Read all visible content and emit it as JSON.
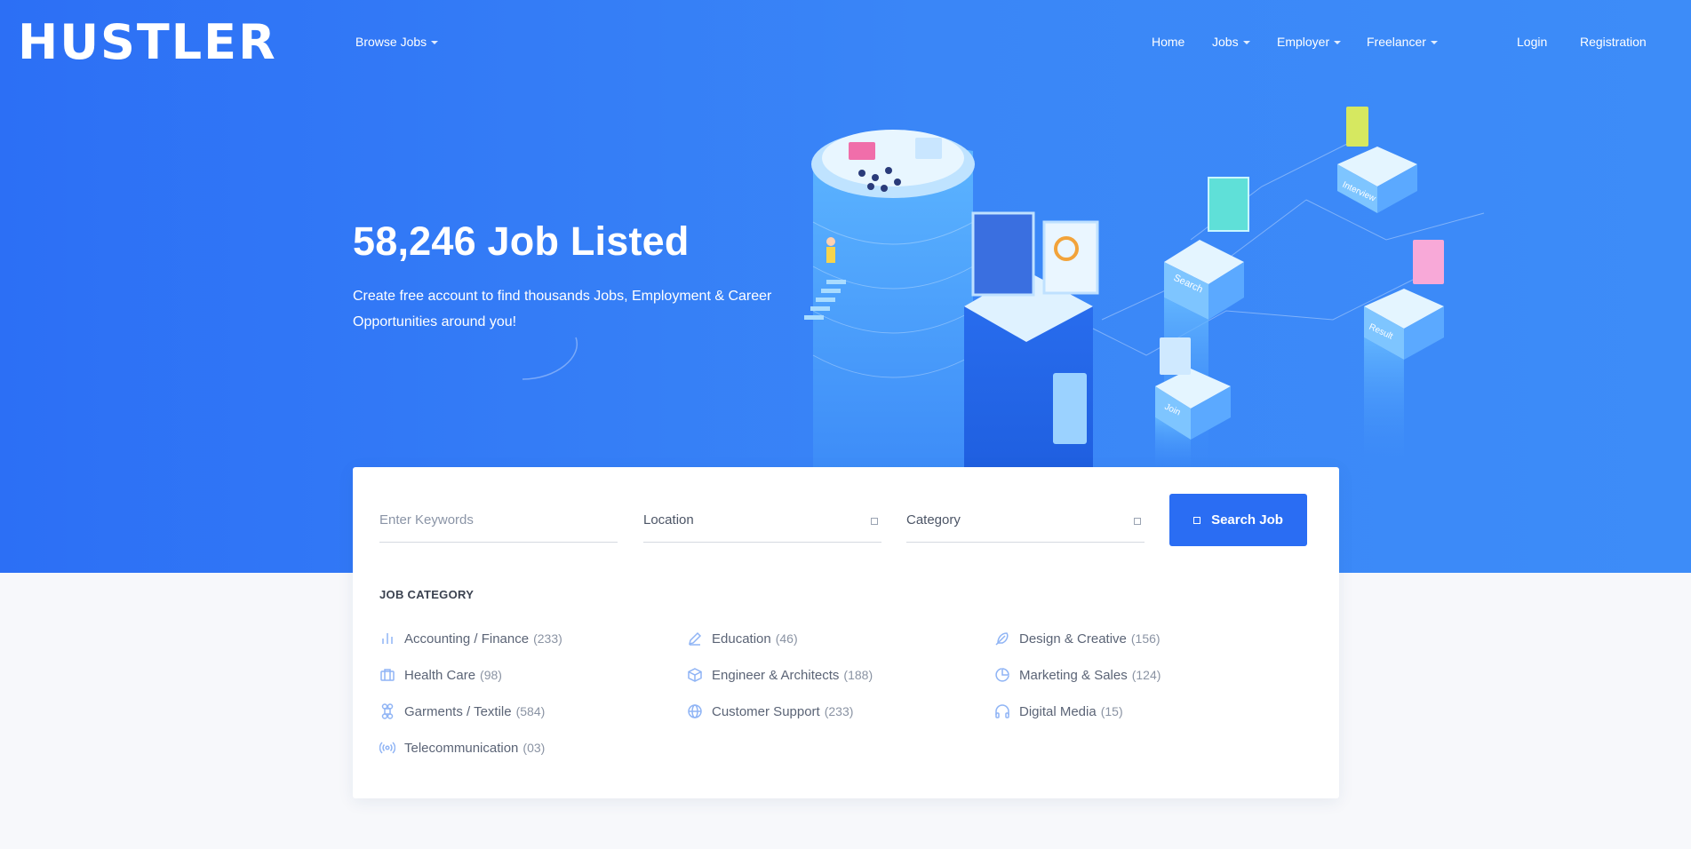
{
  "header": {
    "logo": "HUSTLER",
    "browse_jobs": "Browse Jobs",
    "nav": [
      "Home",
      "Jobs",
      "Employer",
      "Freelancer"
    ],
    "login": "Login",
    "registration": "Registration"
  },
  "hero": {
    "headline": "58,246 Job Listed",
    "subline": "Create free account to find thousands Jobs, Employment & Career Opportunities around you!"
  },
  "illustration_labels": [
    "Search",
    "Interview",
    "Join",
    "Result"
  ],
  "search": {
    "keywords_placeholder": "Enter Keywords",
    "location": "Location",
    "category": "Category",
    "button": "Search Job"
  },
  "categories": {
    "title": "JOB CATEGORY",
    "items": [
      {
        "label": "Accounting / Finance",
        "count": "(233)",
        "icon": "bar-chart-icon"
      },
      {
        "label": "Education",
        "count": "(46)",
        "icon": "pencil-icon"
      },
      {
        "label": "Design & Creative",
        "count": "(156)",
        "icon": "feather-icon"
      },
      {
        "label": "Health Care",
        "count": "(98)",
        "icon": "briefcase-icon"
      },
      {
        "label": "Engineer & Architects",
        "count": "(188)",
        "icon": "box-icon"
      },
      {
        "label": "Marketing & Sales",
        "count": "(124)",
        "icon": "pie-chart-icon"
      },
      {
        "label": "Garments / Textile",
        "count": "(584)",
        "icon": "command-icon"
      },
      {
        "label": "Customer Support",
        "count": "(233)",
        "icon": "globe-icon"
      },
      {
        "label": "Digital Media",
        "count": "(15)",
        "icon": "headphones-icon"
      },
      {
        "label": "Telecommunication",
        "count": "(03)",
        "icon": "radio-icon"
      }
    ]
  },
  "colors": {
    "hero_start": "#2c6ff5",
    "hero_end": "#3d8cf8",
    "button": "#2a6df3",
    "icon": "#8fb4f5"
  }
}
